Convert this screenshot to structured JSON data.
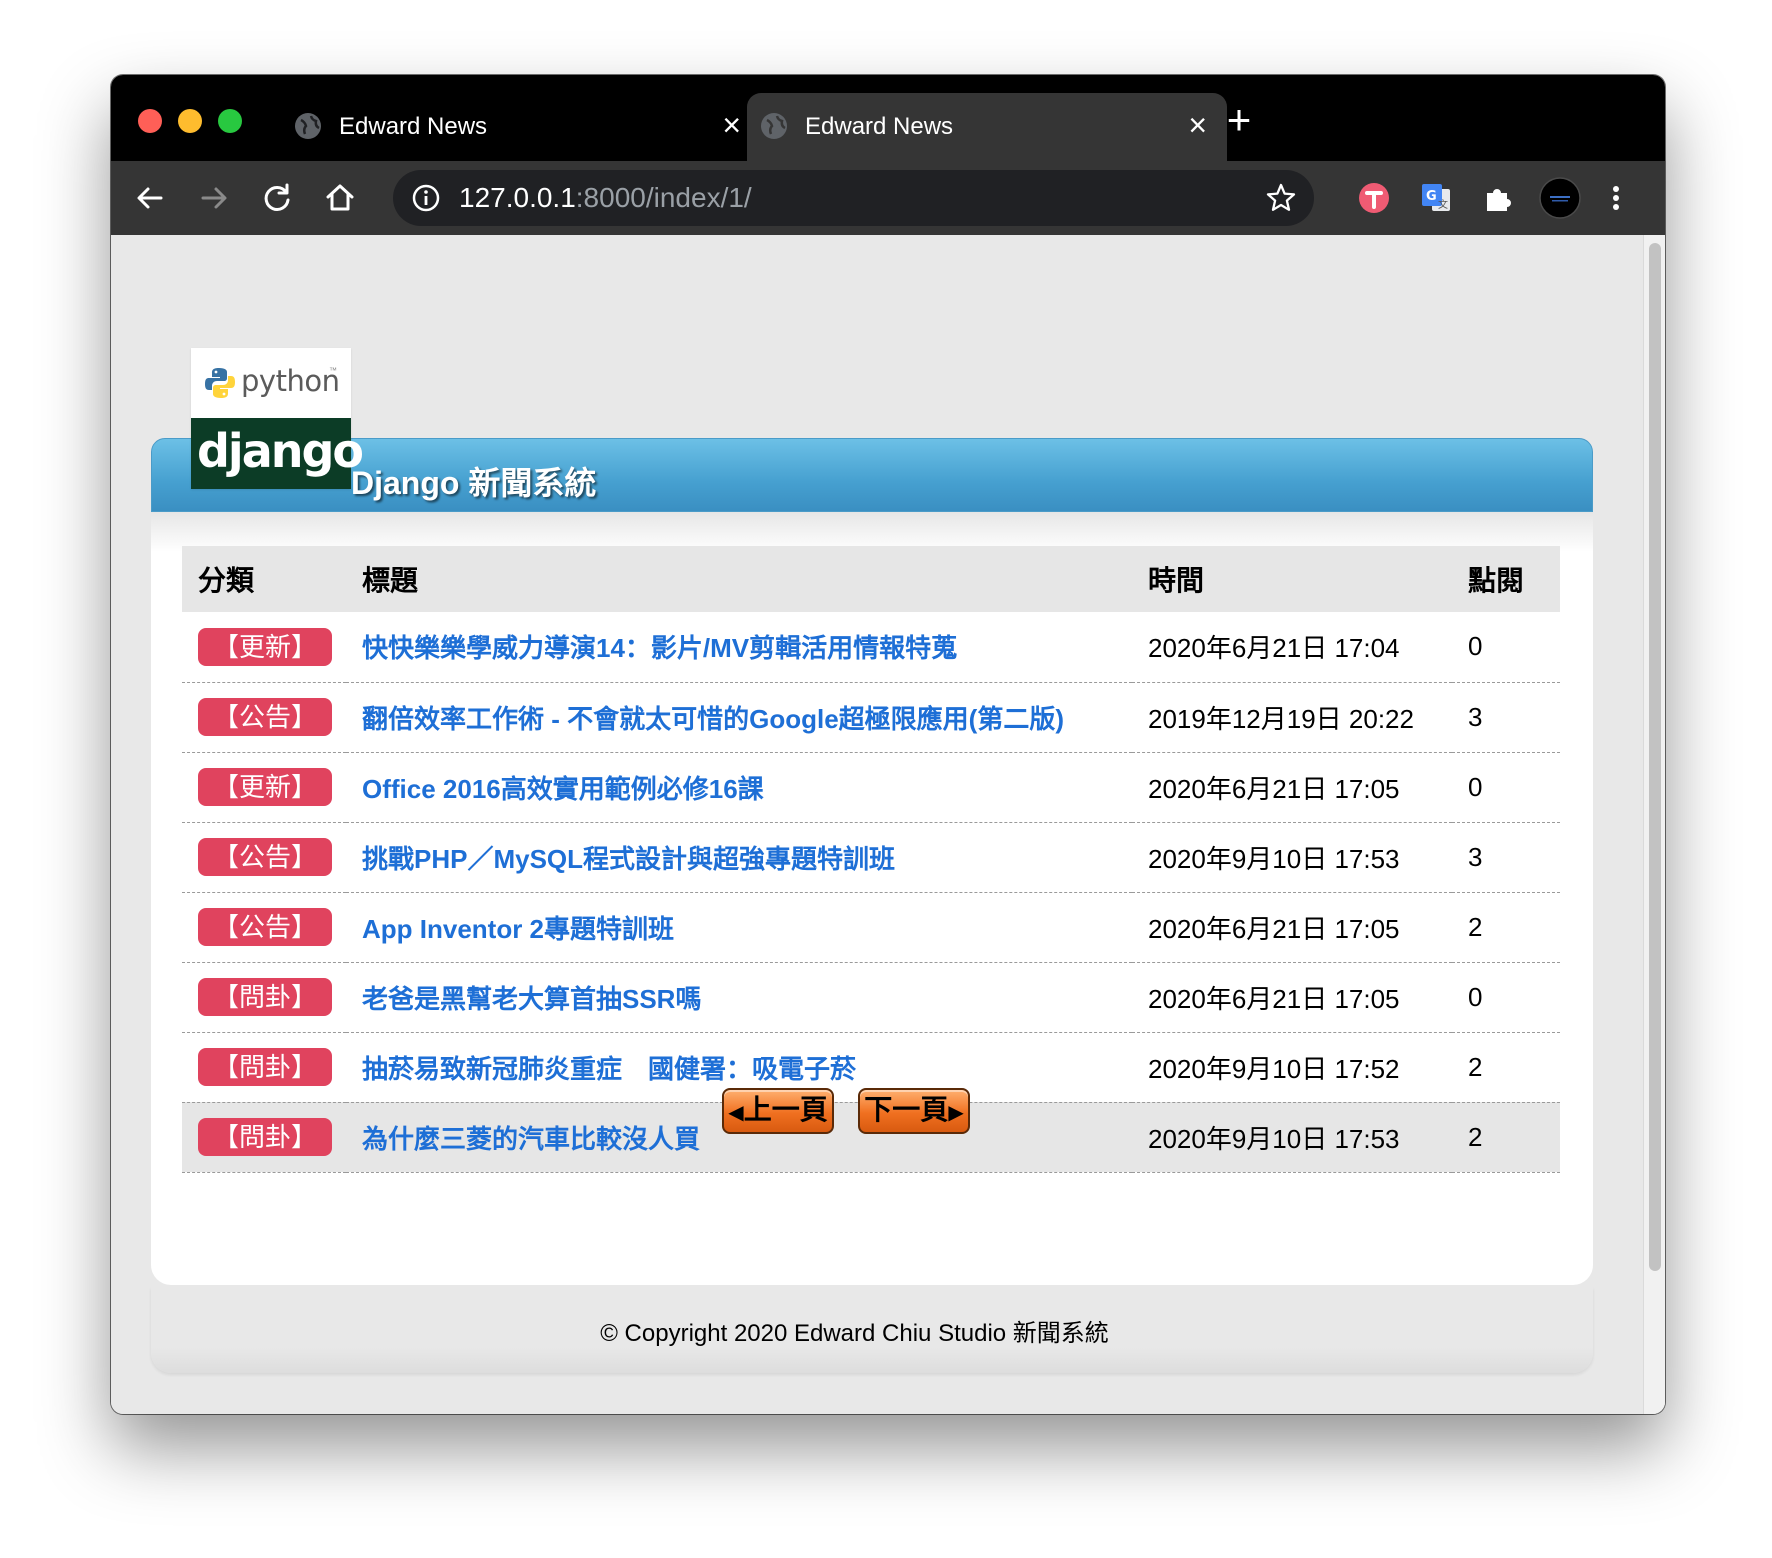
{
  "browser": {
    "tabs": [
      {
        "title": "Edward News"
      },
      {
        "title": "Edward News"
      }
    ],
    "address": {
      "host": "127.0.0.1",
      "rest": ":8000/index/1/"
    }
  },
  "site": {
    "logo": {
      "python": "python",
      "tm": "™",
      "django": "django"
    },
    "title": "Django 新聞系統"
  },
  "table": {
    "headers": {
      "category": "分類",
      "title": "標題",
      "time": "時間",
      "views": "點閱"
    },
    "rows": [
      {
        "category": "【更新】",
        "title": "快快樂樂學威力導演14：影片/MV剪輯活用情報特蒐",
        "time": "2020年6月21日 17:04",
        "views": "0"
      },
      {
        "category": "【公告】",
        "title": "翻倍效率工作術 - 不會就太可惜的Google超極限應用(第二版)",
        "time": "2019年12月19日 20:22",
        "views": "3"
      },
      {
        "category": "【更新】",
        "title": "Office 2016高效實用範例必修16課",
        "time": "2020年6月21日 17:05",
        "views": "0"
      },
      {
        "category": "【公告】",
        "title": "挑戰PHP／MySQL程式設計與超強專題特訓班",
        "time": "2020年9月10日 17:53",
        "views": "3"
      },
      {
        "category": "【公告】",
        "title": "App Inventor 2專題特訓班",
        "time": "2020年6月21日 17:05",
        "views": "2"
      },
      {
        "category": "【問卦】",
        "title": "老爸是黑幫老大算首抽SSR嗎",
        "time": "2020年6月21日 17:05",
        "views": "0"
      },
      {
        "category": "【問卦】",
        "title": "抽菸易致新冠肺炎重症　國健署：吸電子菸",
        "time": "2020年9月10日 17:52",
        "views": "2"
      },
      {
        "category": "【問卦】",
        "title": "為什麼三菱的汽車比較沒人買",
        "time": "2020年9月10日 17:53",
        "views": "2"
      }
    ]
  },
  "pager": {
    "prev": "上一頁",
    "next": "下一頁"
  },
  "footer": {
    "copyright": "© Copyright 2020 Edward Chiu Studio 新聞系統"
  },
  "colors": {
    "header_blue": "#46a0d0",
    "badge_red": "#e0435e",
    "link_blue": "#1e6fd6",
    "pager_orange": "#f07020"
  }
}
